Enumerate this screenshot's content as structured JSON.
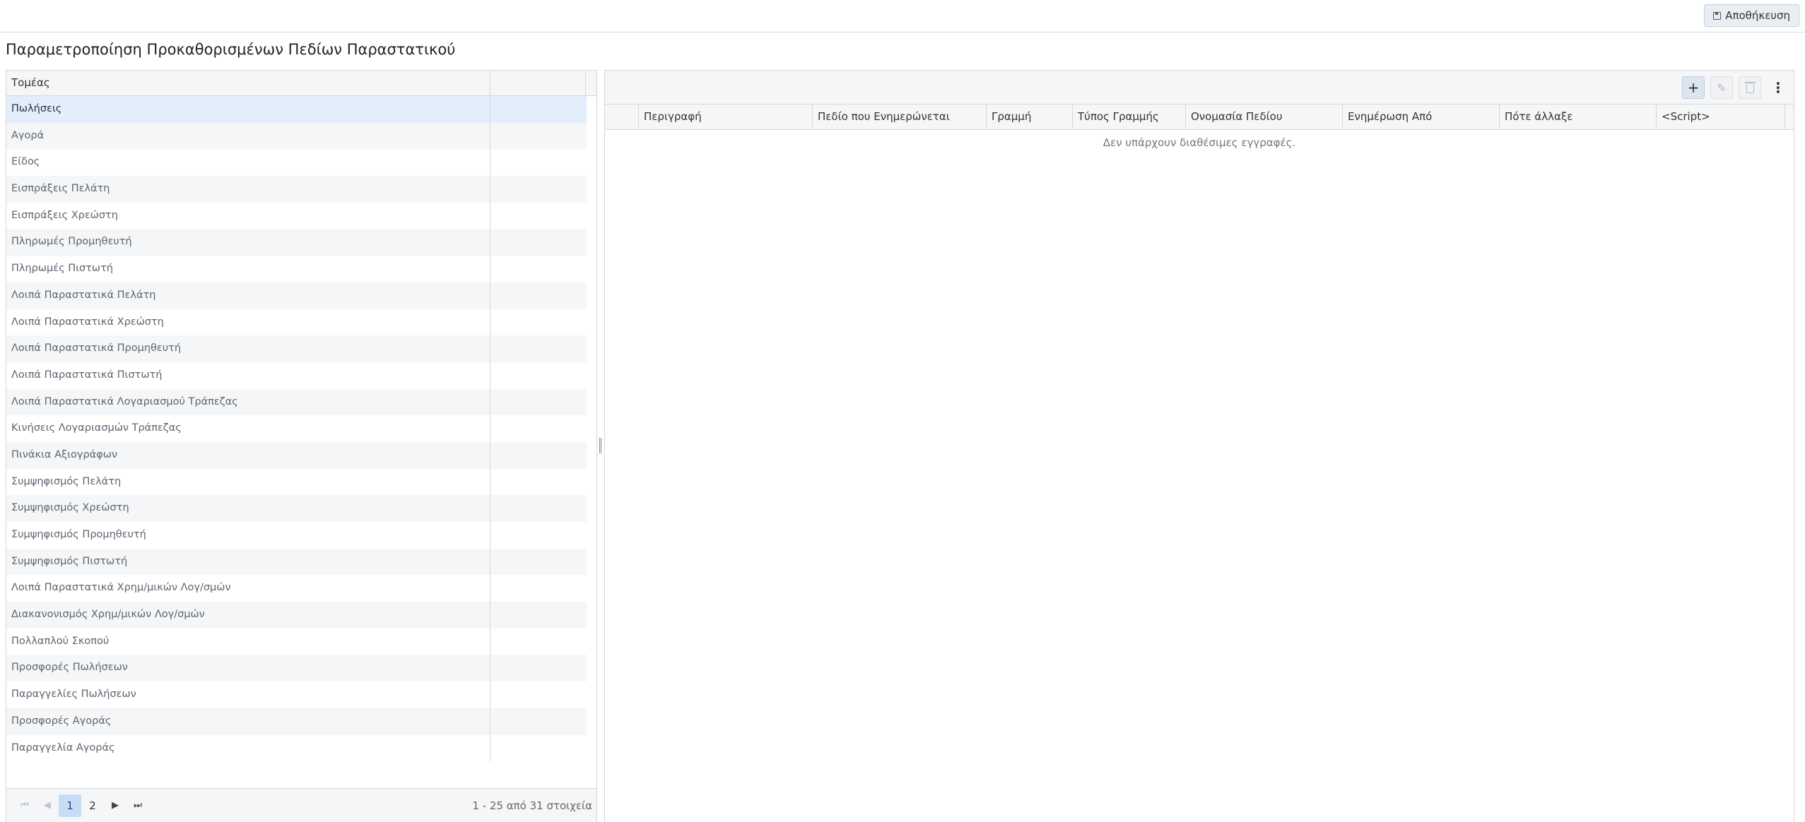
{
  "toolbar": {
    "save_label": "Αποθήκευση"
  },
  "page": {
    "title": "Παραμετροποίηση Προκαθορισμένων Πεδίων Παραστατικού"
  },
  "left_grid": {
    "header": "Τομέας",
    "rows": [
      "Πωλήσεις",
      "Αγορά",
      "Είδος",
      "Εισπράξεις Πελάτη",
      "Εισπράξεις Χρεώστη",
      "Πληρωμές Προμηθευτή",
      "Πληρωμές Πιστωτή",
      "Λοιπά Παραστατικά Πελάτη",
      "Λοιπά Παραστατικά Χρεώστη",
      "Λοιπά Παραστατικά Προμηθευτή",
      "Λοιπά Παραστατικά Πιστωτή",
      "Λοιπά Παραστατικά Λογαριασμού Τράπεζας",
      "Κινήσεις Λογαριασμών Τράπεζας",
      "Πινάκια Αξιογράφων",
      "Συμψηφισμός Πελάτη",
      "Συμψηφισμός Χρεώστη",
      "Συμψηφισμός Προμηθευτή",
      "Συμψηφισμός Πιστωτή",
      "Λοιπά Παραστατικά Χρημ/μικών Λογ/σμών",
      "Διακανονισμός Χρημ/μικών Λογ/σμών",
      "Πολλαπλού Σκοπού",
      "Προσφορές Πωλήσεων",
      "Παραγγελίες Πωλήσεων",
      "Προσφορές Αγοράς",
      "Παραγγελία Αγοράς"
    ],
    "selected_index": 0,
    "pager": {
      "pages": [
        "1",
        "2"
      ],
      "current_page": "1",
      "info": "1 - 25 από 31 στοιχεία"
    }
  },
  "right_grid": {
    "columns": [
      "Περιγραφή",
      "Πεδίο που Ενημερώνεται",
      "Γραμμή",
      "Τύπος Γραμμής",
      "Ονομασία Πεδίου",
      "Ενημέρωση Από",
      "Πότε άλλαξε",
      "<Script>"
    ],
    "empty_message": "Δεν υπάρχουν διαθέσιμες εγγραφές.",
    "buttons": [
      "add-icon",
      "edit-icon",
      "delete-icon",
      "more-options-icon"
    ]
  }
}
